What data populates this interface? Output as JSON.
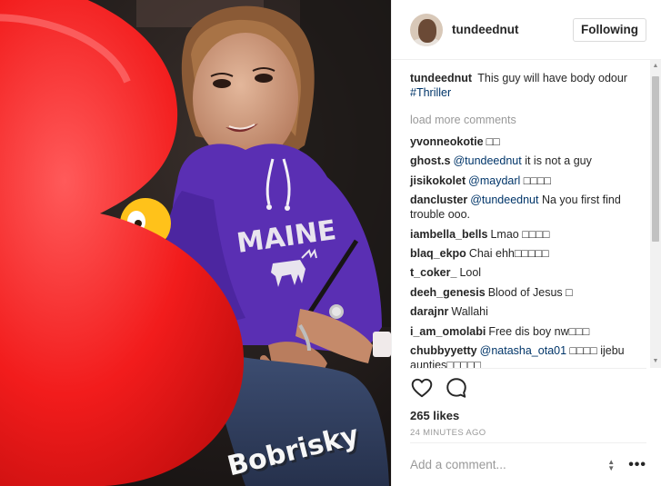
{
  "post": {
    "header": {
      "username": "tundeednut",
      "follow_label": "Following"
    },
    "photo": {
      "watermark": "Bobrisky",
      "hoodie_text": "MAINE"
    },
    "caption": {
      "user": "tundeednut",
      "text": "This guy will have body odour",
      "hashtag": "#Thriller"
    },
    "load_more": "load more comments",
    "comments": [
      {
        "user": "yvonneokotie",
        "mention": "",
        "text": "□□"
      },
      {
        "user": "ghost.s",
        "mention": "@tundeednut",
        "text": "it is not a guy"
      },
      {
        "user": "jisikokolet",
        "mention": "@maydarl",
        "text": "□□□□"
      },
      {
        "user": "dancluster",
        "mention": "@tundeednut",
        "text": "Na you first find trouble ooo."
      },
      {
        "user": "iambella_bells",
        "mention": "",
        "text": "Lmao □□□□"
      },
      {
        "user": "blaq_ekpo",
        "mention": "",
        "text": "Chai ehh□□□□□"
      },
      {
        "user": "t_coker_",
        "mention": "",
        "text": "Lool"
      },
      {
        "user": "deeh_genesis",
        "mention": "",
        "text": "Blood of Jesus □"
      },
      {
        "user": "darajnr",
        "mention": "",
        "text": "Wallahi"
      },
      {
        "user": "i_am_omolabi",
        "mention": "",
        "text": "Free dis boy nw□□□"
      },
      {
        "user": "chubbyyetty",
        "mention": "@natasha_ota01",
        "text": "□□□□ ijebu aunties□□□□□"
      }
    ],
    "likes": "265 likes",
    "time": "24 MINUTES AGO",
    "add_comment_placeholder": "Add a comment...",
    "more_label": "•••",
    "icons": {
      "like": "heart-icon",
      "comment": "comment-bubble-icon",
      "more": "more-options-icon"
    },
    "colors": {
      "link": "#003569",
      "muted": "#999999",
      "hoodie": "#5a2fb3",
      "sticker_red": "#f21c1c"
    }
  }
}
